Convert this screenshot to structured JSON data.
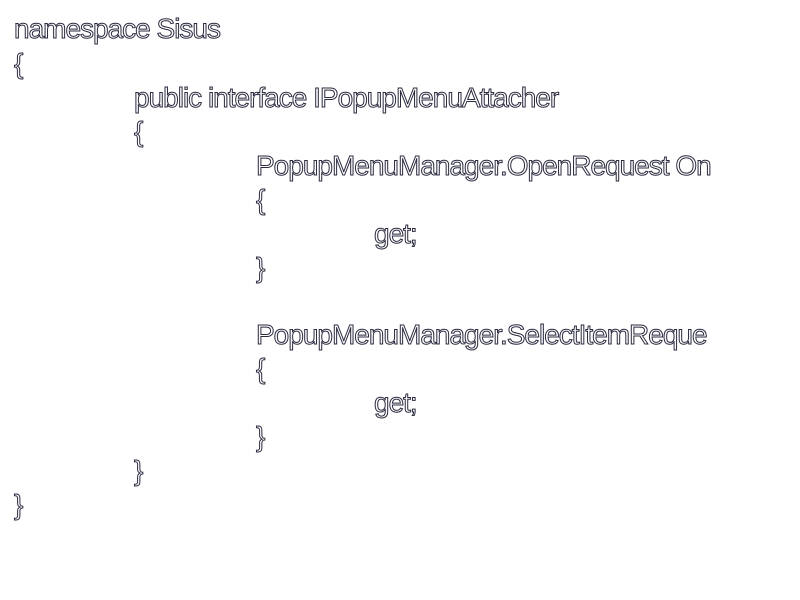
{
  "code": {
    "lines": [
      "namespace Sisus",
      "{",
      "public interface IPopupMenuAttacher",
      "{",
      "PopupMenuManager.OpenRequest On",
      "{",
      "get;",
      "}",
      "PopupMenuManager.SelectItemReque",
      "{",
      "get;",
      "}",
      "}",
      "}"
    ]
  }
}
